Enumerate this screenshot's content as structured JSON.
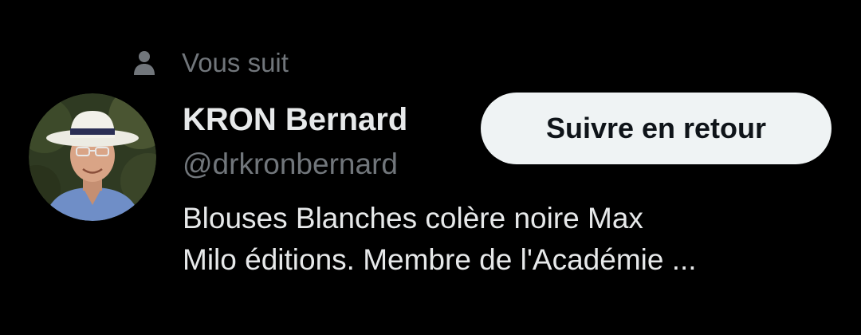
{
  "social_context": {
    "icon": "person-icon",
    "text": "Vous suit"
  },
  "user": {
    "avatar_icon": "avatar-photo",
    "name": "KRON Bernard",
    "handle": "@drkronbernard",
    "bio_lines": [
      "Blouses Blanches colère noire Max",
      "Milo éditions. Membre de l'Académie ..."
    ]
  },
  "actions": {
    "follow_back_label": "Suivre en retour"
  },
  "colors": {
    "background": "#000000",
    "primary_text": "#e7e9ea",
    "secondary_text": "#71767b",
    "button_bg": "#eff3f4",
    "button_text": "#0f1419"
  }
}
